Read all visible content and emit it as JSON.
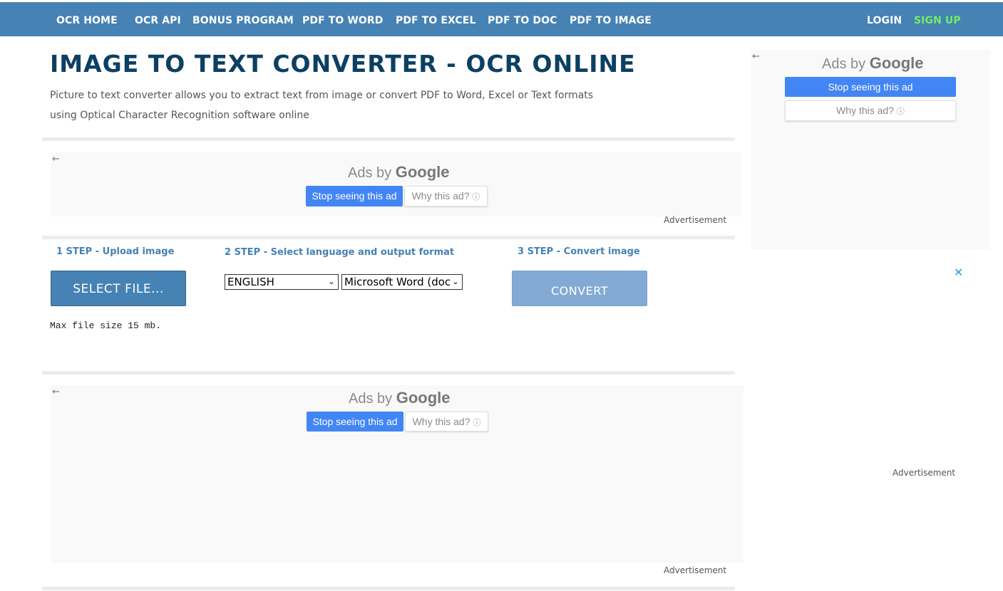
{
  "nav": {
    "items": [
      "OCR HOME",
      "OCR API",
      "BONUS PROGRAM",
      "PDF TO WORD",
      "PDF TO EXCEL",
      "PDF TO DOC",
      "PDF TO IMAGE"
    ],
    "login": "LOGIN",
    "signup": "SIGN UP"
  },
  "header": {
    "title": "IMAGE TO TEXT CONVERTER - OCR ONLINE",
    "subtitle": "Picture to text converter allows you to extract text from image or convert PDF to Word, Excel or Text formats using Optical Character Recognition software online"
  },
  "ads": {
    "back_icon": "←",
    "ads_by": "Ads by",
    "google": "Google",
    "stop": "Stop seeing this ad",
    "why": "Why this ad?",
    "info_icon": "ⓘ",
    "advertisement": "Advertisement",
    "close_icon": "✕"
  },
  "steps": {
    "step1": "1 STEP - Upload image",
    "step2": "2 STEP - Select language and output format",
    "step3": "3 STEP - Convert image",
    "select_file": "SELECT FILE...",
    "max_size": "Max file size 15 mb.",
    "language": "ENGLISH",
    "format": "Microsoft Word (doc",
    "convert": "CONVERT",
    "caret_icon": "⌄"
  },
  "colors": {
    "topbar": "#4682b4",
    "signup": "#6ef062",
    "title": "#0c4063",
    "stop_button": "#4285f4",
    "convert_button": "#82aad4"
  }
}
